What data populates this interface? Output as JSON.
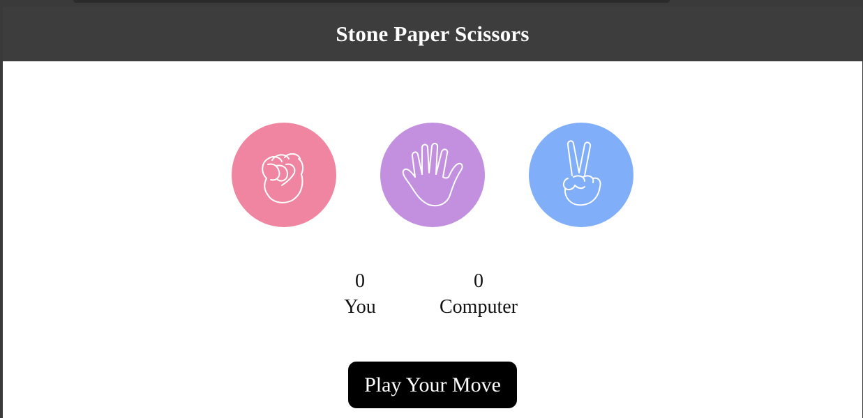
{
  "header": {
    "title": "Stone Paper Scissors"
  },
  "choices": [
    {
      "name": "stone",
      "icon": "fist-icon",
      "color": "#ef85a1"
    },
    {
      "name": "paper",
      "icon": "open-hand-icon",
      "color": "#c290de"
    },
    {
      "name": "scissors",
      "icon": "peace-sign-icon",
      "color": "#80aef9"
    }
  ],
  "scoreboard": {
    "you": {
      "score": "0",
      "label": "You"
    },
    "computer": {
      "score": "0",
      "label": "Computer"
    }
  },
  "play_button": {
    "label": "Play Your Move"
  },
  "colors": {
    "header_bg": "#3d3d3d",
    "content_bg": "#ffffff",
    "button_bg": "#000000"
  }
}
